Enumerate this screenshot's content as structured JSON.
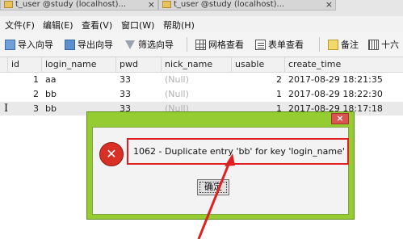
{
  "tabs": [
    {
      "label": "t_user @study (localhost)...",
      "close": "×"
    },
    {
      "label": "t_user @study (localhost)...",
      "close": "×"
    }
  ],
  "menu": {
    "file": "文件(F)",
    "edit": "编辑(E)",
    "view": "查看(V)",
    "window": "窗口(W)",
    "help": "帮助(H)"
  },
  "toolbar": {
    "import_wizard": "导入向导",
    "export_wizard": "导出向导",
    "filter_wizard": "筛选向导",
    "grid_view": "网格查看",
    "form_view": "表单查看",
    "memo": "备注",
    "hex": "十六"
  },
  "grid": {
    "columns": [
      "id",
      "login_name",
      "pwd",
      "nick_name",
      "usable",
      "create_time"
    ],
    "rows": [
      {
        "id": "1",
        "login_name": "aa",
        "pwd": "33",
        "nick_name": "(Null)",
        "usable": "2",
        "create_time": "2017-08-29 18:21:35"
      },
      {
        "id": "2",
        "login_name": "bb",
        "pwd": "33",
        "nick_name": "(Null)",
        "usable": "1",
        "create_time": "2017-08-29 18:22:30"
      },
      {
        "id": "3",
        "login_name": "bb",
        "pwd": "33",
        "nick_name": "(Null)",
        "usable": "1",
        "create_time": "2017-08-29 18:17:18"
      }
    ]
  },
  "dialog": {
    "close": "×",
    "message": "1062 - Duplicate entry 'bb' for key 'login_name'",
    "ok_label": "确定"
  },
  "colors": {
    "dialog_frame": "#95cc31",
    "highlight": "#e02020",
    "error_icon": "#d93025"
  }
}
